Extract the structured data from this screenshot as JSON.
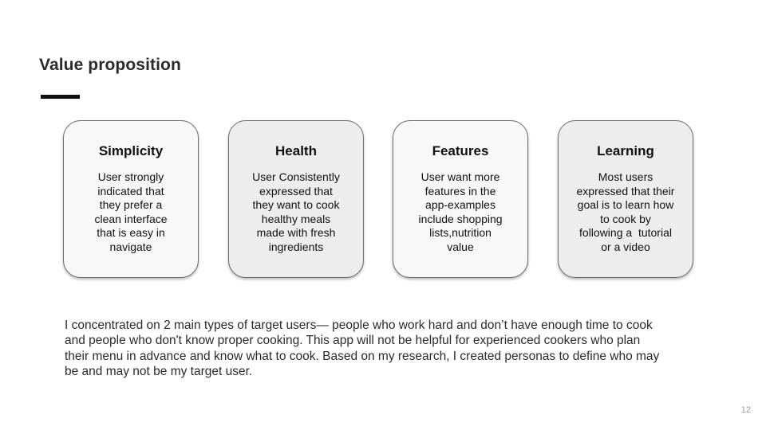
{
  "slide": {
    "title": "Value proposition",
    "page_number": "12"
  },
  "cards": [
    {
      "title": "Simplicity",
      "body": "User strongly indicated that they prefer a clean interface that is easy in navigate"
    },
    {
      "title": "Health",
      "body": "User Consistently expressed that they want to cook healthy meals made with fresh ingredients"
    },
    {
      "title": "Features",
      "body": "User want more features in the app-examples include shopping lists,nutrition value"
    },
    {
      "title": "Learning",
      "body": "Most users expressed that their goal is to learn how to cook by following a  tutorial or a video"
    }
  ],
  "description": "I concentrated on 2 main types of target users— people who work hard and don’t have enough time to cook and people who don't know proper cooking. This app will not be helpful for experienced cookers who plan their menu in advance and know what to cook. Based on my research, I created personas to define who may be and may not be my target user.",
  "colors": {
    "card_light": "#f8f8f8",
    "card_dark": "#ededed",
    "card_border": "#6d6d6d",
    "accent_bar": "#111111"
  }
}
